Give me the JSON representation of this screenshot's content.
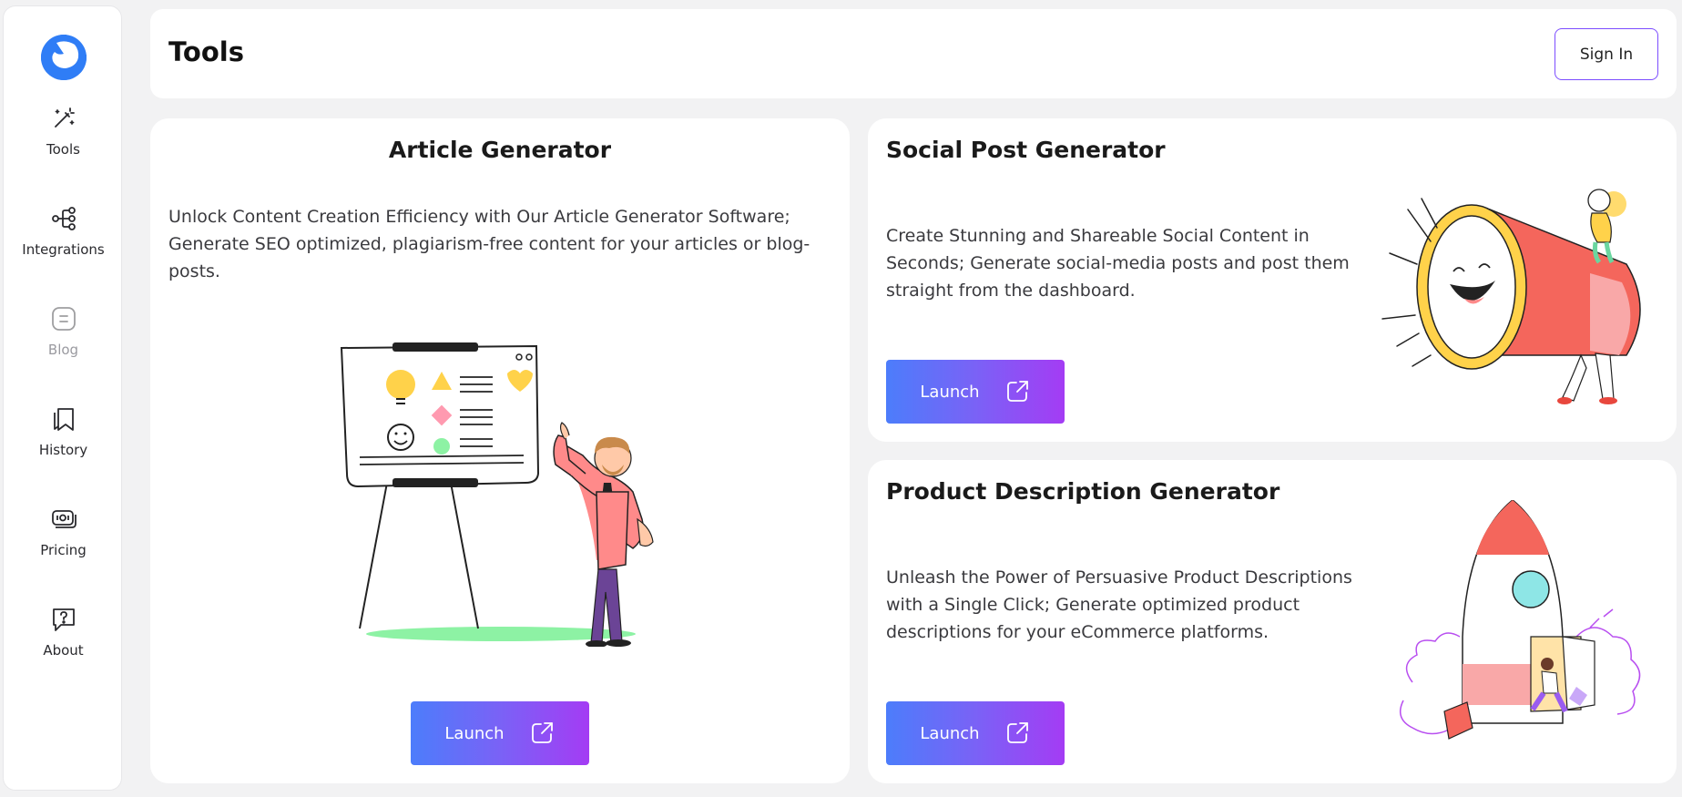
{
  "sidebar": {
    "items": [
      {
        "label": "Tools",
        "icon": "magic-wand-icon"
      },
      {
        "label": "Integrations",
        "icon": "integrations-icon"
      },
      {
        "label": "Blog",
        "icon": "blog-icon"
      },
      {
        "label": "History",
        "icon": "history-icon"
      },
      {
        "label": "Pricing",
        "icon": "pricing-icon"
      },
      {
        "label": "About",
        "icon": "about-icon"
      }
    ]
  },
  "header": {
    "title": "Tools",
    "signin_label": "Sign In"
  },
  "cards": [
    {
      "title": "Article Generator",
      "description": "Unlock Content Creation Efficiency with Our Article Generator Software; Generate SEO optimized, plagiarism-free content for your articles or blog-posts.",
      "button_label": "Launch"
    },
    {
      "title": "Social Post Generator",
      "description": "Create Stunning and Shareable Social Content in Seconds; Generate social-media posts and post them straight from the dashboard.",
      "button_label": "Launch"
    },
    {
      "title": "Product Description Generator",
      "description": "Unleash the Power of Persuasive Product Descriptions with a Single Click; Generate optimized product descriptions for your eCommerce platforms.",
      "button_label": "Launch"
    }
  ],
  "colors": {
    "accent_start": "#4c7dfb",
    "accent_end": "#a43cf4",
    "logo": "#2f7df6",
    "background": "#f2f2f3"
  }
}
